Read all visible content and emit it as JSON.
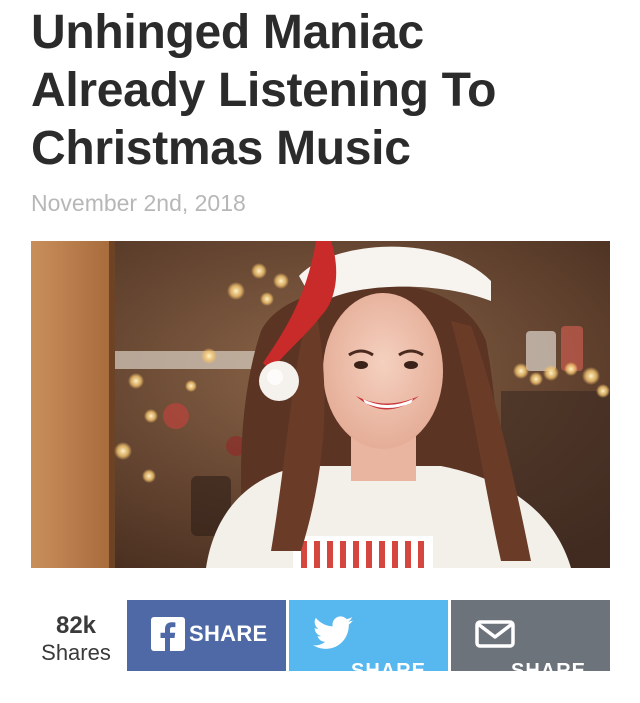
{
  "article": {
    "headline_lines": [
      "Unhinged Maniac",
      "Already Listening To",
      "Christmas Music"
    ],
    "date": "November 2nd, 2018"
  },
  "share": {
    "count": "82k",
    "count_label": "Shares",
    "facebook_label": "SHARE",
    "twitter_label": "SHARE",
    "email_label": "SHARE",
    "icons": [
      "facebook-icon",
      "twitter-icon",
      "email-icon"
    ]
  },
  "colors": {
    "facebook": "#4e69a5",
    "twitter": "#56b8ee",
    "email": "#6d737a",
    "headline": "#2b2b2b",
    "date": "#b7b7b7"
  }
}
